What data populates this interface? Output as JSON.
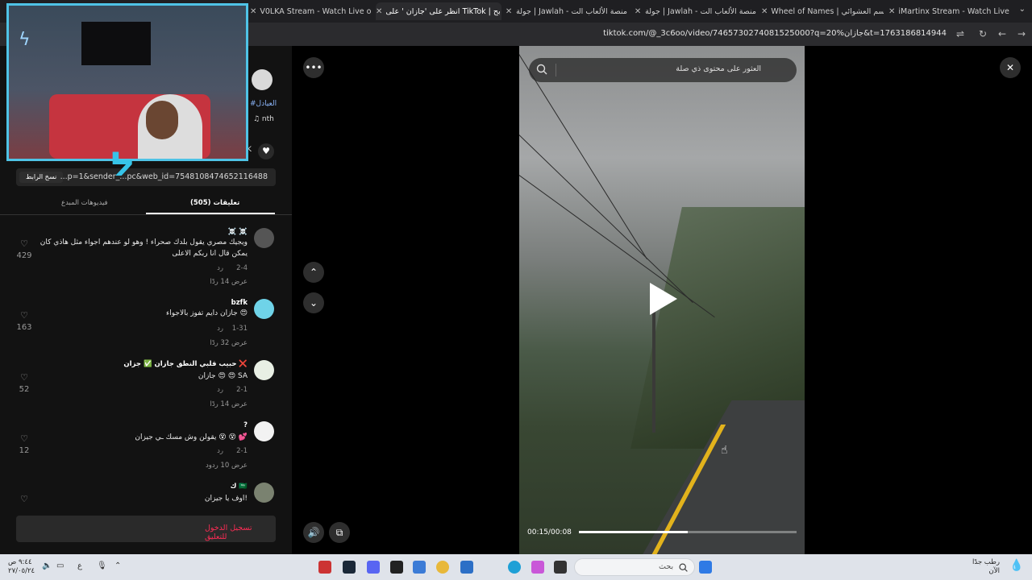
{
  "browser": {
    "tabs": [
      {
        "title": "V0LKA Stream - Watch Live on",
        "color": "#53fc18"
      },
      {
        "title": "انظر على 'جازان ' على TikTok | بح",
        "color": "#25f4ee"
      },
      {
        "title": "جولة | Jawlah - منصة الألعاب الت",
        "color": "#444"
      },
      {
        "title": "جولة | Jawlah - منصة الألعاب الت",
        "color": "#444"
      },
      {
        "title": "Wheel of Names | الاسم العشوائي",
        "color": "#ff9c00"
      },
      {
        "title": "iMartinx Stream - Watch Live on",
        "color": "#53fc18"
      }
    ],
    "url": "tiktok.com/@_3c6oo/video/7465730274081525000?q=20%جازان&t=1763186814944"
  },
  "sidebar": {
    "hashtag": "#العيادل",
    "music": "♫ nth",
    "like_count": "K",
    "copy_link_label": "نسخ الرابط",
    "link_text": "...p=1&sender_...pc&web_id=7548108474652116488",
    "tab_creator_videos": "فيديوهات المبدع",
    "tab_comments": "(505) تعليقات",
    "login_prompt": "تسجيل الدخول للتعليق"
  },
  "comments": [
    {
      "name": "☠️ ☠️",
      "text_lines": [
        "ويجيك مصري يقول بلدك صحراء ! وهو لو عندهم اجواء مثل هاذي كان",
        "يمكن قال انا ربكم الاعلى"
      ],
      "date": "2-4",
      "reply_label": "رد",
      "view_replies": "عرض 14 ردًا",
      "likes": "429",
      "avatar_color": "#555"
    },
    {
      "name": "bzfk",
      "text_lines": [
        "جازان دايم تفوز بالاجواء 😍"
      ],
      "date": "1-31",
      "reply_label": "رد",
      "view_replies": "عرض 32 ردًا",
      "likes": "163",
      "avatar_color": "#6fd3e8"
    },
    {
      "name": "حبيب قلبي النطق جازان ✅ جزان ❌",
      "text_lines": [
        "جازان 😍 😍 SA"
      ],
      "date": "2-1",
      "reply_label": "رد",
      "view_replies": "عرض 14 ردًا",
      "likes": "52",
      "avatar_color": "#e8efe4"
    },
    {
      "name": "?",
      "text_lines": [
        "يقولن وش مسك ـي جيزان 😵 😵 💕"
      ],
      "date": "2-1",
      "reply_label": "رد",
      "view_replies": "عرض 10 ردود",
      "likes": "12",
      "avatar_color": "#f2f2f2"
    },
    {
      "name": "ك 🇸🇦",
      "text_lines": [
        "اوف يا جيزان!"
      ],
      "date": "",
      "reply_label": "",
      "view_replies": "",
      "likes": "",
      "avatar_color": "#7a8270"
    }
  ],
  "video": {
    "search_placeholder": "العثور على محتوى ذي صلة",
    "time": "00:15/00:08",
    "progress": 0.5
  },
  "taskbar": {
    "search_placeholder": "بحث",
    "weather_line1": "رطب جدًا",
    "weather_line2": "الآن",
    "clock_line1": "٩:٤٤ ص",
    "clock_line2": "٢٧/٠٥/٢٤",
    "lang": "ع"
  }
}
